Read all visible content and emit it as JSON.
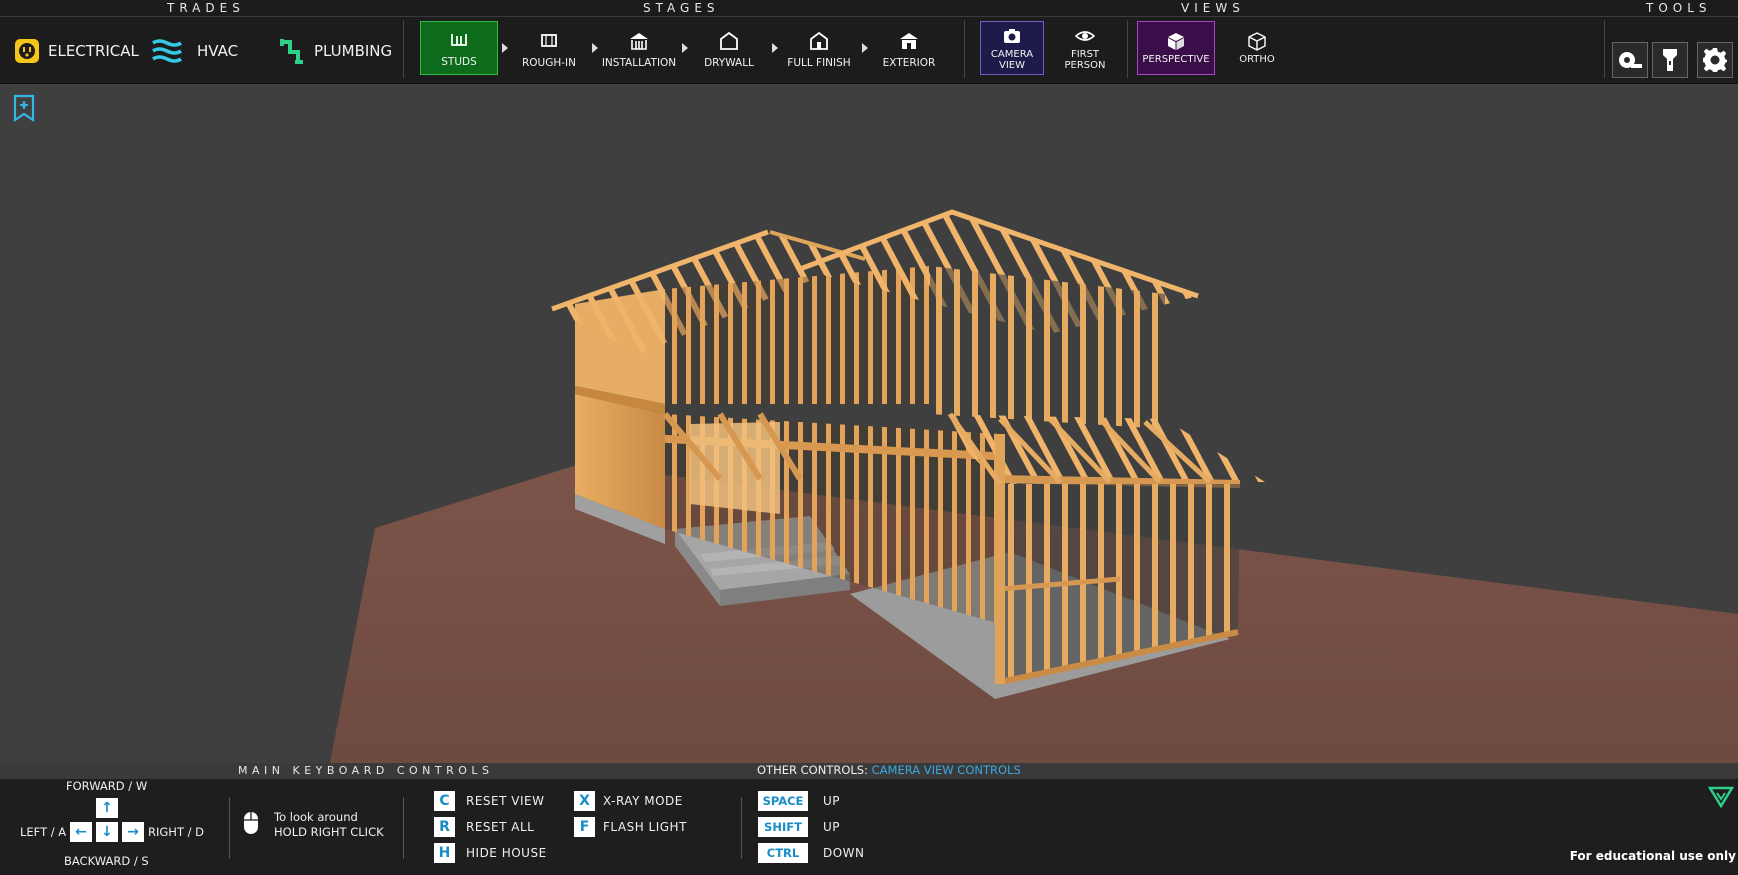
{
  "header": {
    "sections": {
      "trades": "TRADES",
      "stages": "STAGES",
      "views": "VIEWS",
      "tools": "TOOLS"
    },
    "trades": [
      {
        "label": "ELECTRICAL",
        "icon": "outlet-icon",
        "color": "#f5c518"
      },
      {
        "label": "HVAC",
        "icon": "airflow-waves-icon",
        "color": "#35c9e6"
      },
      {
        "label": "PLUMBING",
        "icon": "pipe-icon",
        "color": "#2fd08a"
      }
    ],
    "stages": [
      {
        "label": "STUDS",
        "icon": "studs-icon",
        "active": true
      },
      {
        "label": "ROUGH-IN",
        "icon": "rough-in-icon"
      },
      {
        "label": "INSTALLATION",
        "icon": "installation-icon"
      },
      {
        "label": "DRYWALL",
        "icon": "drywall-icon"
      },
      {
        "label": "FULL FINISH",
        "icon": "full-finish-icon"
      },
      {
        "label": "EXTERIOR",
        "icon": "exterior-icon"
      }
    ],
    "views": [
      {
        "label": "CAMERA\nVIEW",
        "icon": "camera-icon",
        "active": true
      },
      {
        "label": "FIRST\nPERSON",
        "icon": "eye-icon"
      },
      {
        "label": "PERSPECTIVE",
        "icon": "cube-solid-icon",
        "active": true
      },
      {
        "label": "ORTHO",
        "icon": "cube-outline-icon"
      }
    ],
    "tools": [
      {
        "icon": "tape-measure-icon"
      },
      {
        "icon": "flashlight-icon"
      },
      {
        "icon": "gear-icon"
      }
    ],
    "colors": {
      "stage_active": "#0d6b1c",
      "camera_active": "#1e1a4a",
      "perspective_active": "#3a0e49"
    }
  },
  "viewport": {
    "bookmark_icon": "bookmark-add-icon",
    "colors": {
      "background": "#3f3f3f",
      "ground": "#7a5248",
      "lumber": "#e0a45a",
      "concrete": "#a8a8a8"
    }
  },
  "footer": {
    "main_controls_title": "MAIN KEYBOARD CONTROLS",
    "other_controls_label": "OTHER CONTROLS:",
    "other_controls_link": "CAMERA VIEW CONTROLS",
    "movement": {
      "forward": "FORWARD / W",
      "left": "LEFT / A",
      "right": "RIGHT / D",
      "backward": "BACKWARD / S",
      "keys": {
        "up": "↑",
        "left": "←",
        "down": "↓",
        "right": "→"
      }
    },
    "mouse": {
      "line1": "To look around",
      "line2": "HOLD RIGHT CLICK",
      "icon": "mouse-icon"
    },
    "shortcuts_col1": [
      {
        "key": "C",
        "label": "RESET VIEW"
      },
      {
        "key": "R",
        "label": "RESET ALL"
      },
      {
        "key": "H",
        "label": "HIDE HOUSE"
      }
    ],
    "shortcuts_col2": [
      {
        "key": "X",
        "label": "X-RAY MODE"
      },
      {
        "key": "F",
        "label": "FLASH LIGHT"
      }
    ],
    "camera_keys": [
      {
        "key": "SPACE",
        "label": "UP"
      },
      {
        "key": "SHIFT",
        "label": "UP"
      },
      {
        "key": "CTRL",
        "label": "DOWN"
      }
    ],
    "notice": "For educational use only",
    "collapse_icon": "triangle-down-icon"
  }
}
